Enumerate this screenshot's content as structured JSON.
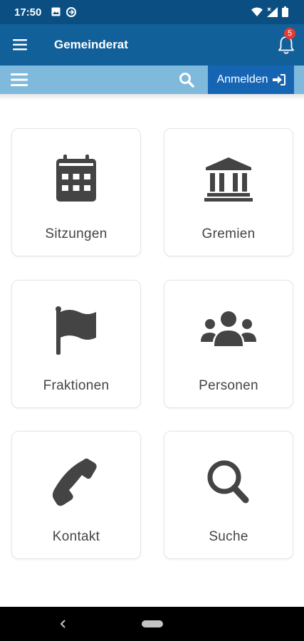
{
  "status": {
    "time": "17:50"
  },
  "app_bar": {
    "title": "Gemeinderat",
    "notification_count": "5"
  },
  "sub_bar": {
    "login_label": "Anmelden"
  },
  "tiles": [
    {
      "label": "Sitzungen",
      "icon": "calendar-icon"
    },
    {
      "label": "Gremien",
      "icon": "institution-icon"
    },
    {
      "label": "Fraktionen",
      "icon": "flag-icon"
    },
    {
      "label": "Personen",
      "icon": "people-group-icon"
    },
    {
      "label": "Kontakt",
      "icon": "phone-icon"
    },
    {
      "label": "Suche",
      "icon": "search-icon"
    }
  ],
  "colors": {
    "status_bar": "#0b4f82",
    "app_bar": "#12609a",
    "sub_bar": "#7fb9dc",
    "login_button": "#1565b3",
    "icon": "#444444",
    "badge": "#e53935"
  }
}
